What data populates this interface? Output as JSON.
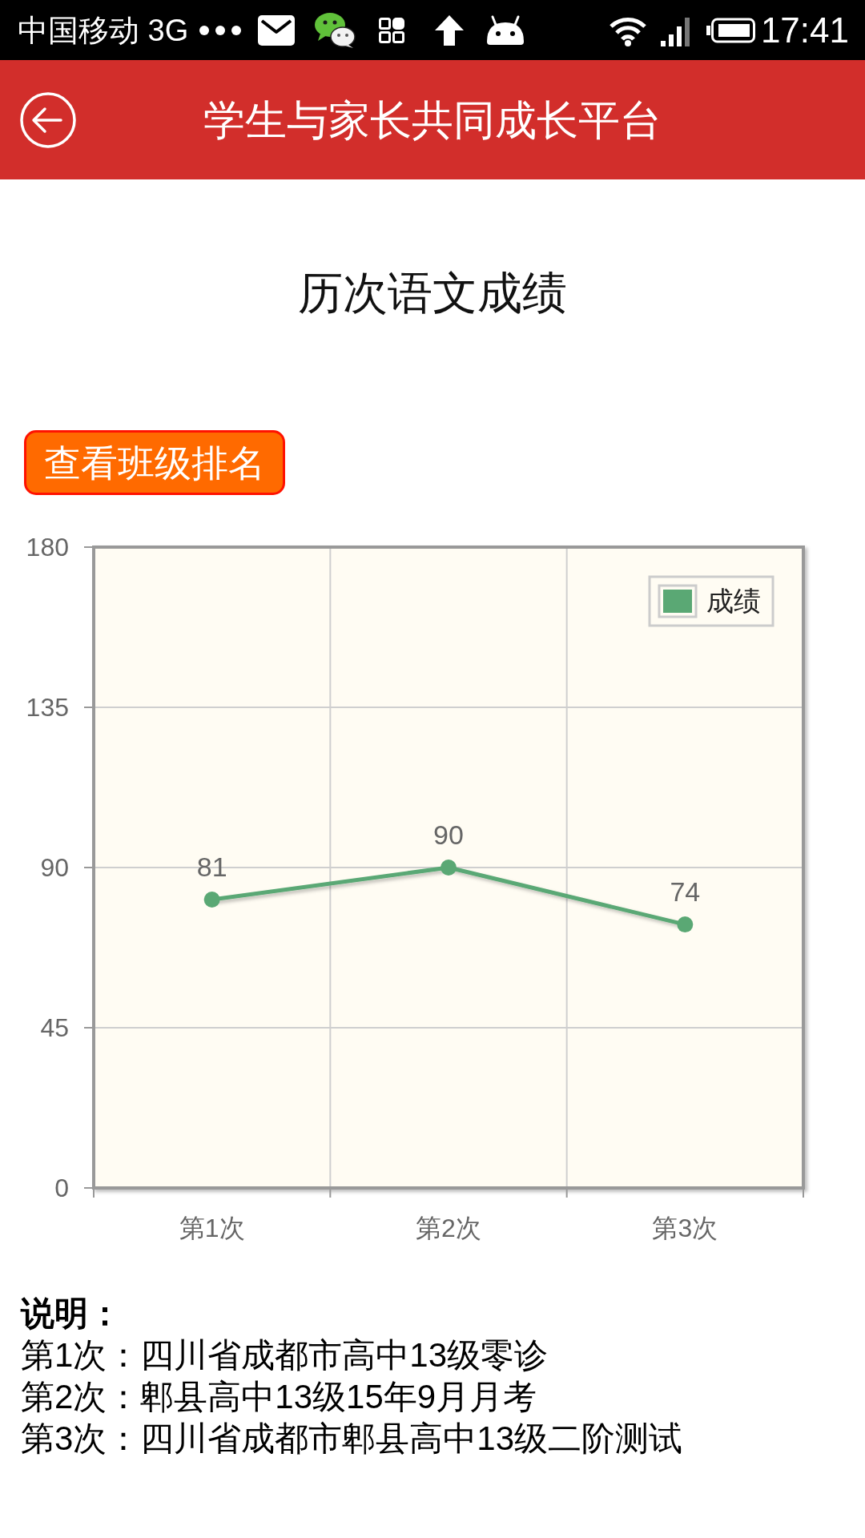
{
  "status_bar": {
    "carrier": "中国移动 3G",
    "time": "17:41"
  },
  "header": {
    "title": "学生与家长共同成长平台"
  },
  "page_title": "历次语文成绩",
  "rank_button": {
    "label": "查看班级排名"
  },
  "chart": {
    "chart_data": {
      "type": "line",
      "categories": [
        "第1次",
        "第2次",
        "第3次"
      ],
      "series": [
        {
          "name": "成绩",
          "color": "#5aa874",
          "values": [
            81,
            90,
            74
          ],
          "marker": true
        }
      ],
      "ylim": [
        0,
        180
      ],
      "yticks": [
        0,
        45,
        90,
        135,
        180
      ],
      "grid": true,
      "data_labels": true
    }
  },
  "notes": {
    "heading": "说明：",
    "lines": [
      "第1次：四川省成都市高中13级零诊",
      "第2次：郫县高中13级15年9月月考",
      "第3次：四川省成都市郫县高中13级二阶测试"
    ]
  }
}
